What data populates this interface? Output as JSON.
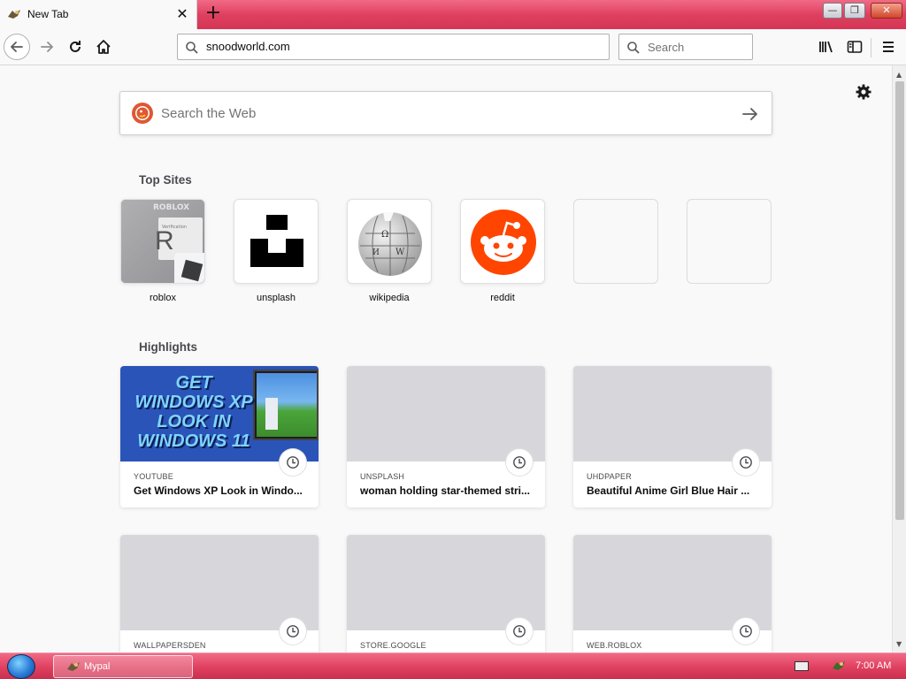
{
  "tab": {
    "title": "New Tab",
    "close_glyph": "✕",
    "new_glyph": "+"
  },
  "window_buttons": {
    "minimize": "—",
    "maximize": "❐",
    "close": "✕"
  },
  "urlbar": {
    "value": "snoodworld.com"
  },
  "searchbar": {
    "placeholder": "Search"
  },
  "websearch": {
    "placeholder": "Search the Web"
  },
  "top_sites": {
    "title": "Top Sites",
    "sites": [
      {
        "label": "roblox",
        "letter": "R",
        "logo_text": "ROBLOX",
        "thumb_text": "Verification"
      },
      {
        "label": "unsplash"
      },
      {
        "label": "wikipedia"
      },
      {
        "label": "reddit"
      },
      {
        "label": ""
      },
      {
        "label": ""
      }
    ]
  },
  "highlights": {
    "title": "Highlights",
    "thumb_text_lines": [
      "GET",
      "WINDOWS XP",
      "LOOK IN",
      "WINDOWS 11"
    ],
    "cards": [
      {
        "source": "YOUTUBE",
        "title": "Get Windows XP Look in Windo..."
      },
      {
        "source": "UNSPLASH",
        "title": "woman holding star-themed stri..."
      },
      {
        "source": "UHDPAPER",
        "title": "Beautiful Anime Girl Blue Hair ..."
      },
      {
        "source": "WALLPAPERSDEN",
        "title": ""
      },
      {
        "source": "STORE.GOOGLE",
        "title": ""
      },
      {
        "source": "WEB.ROBLOX",
        "title": ""
      }
    ]
  },
  "taskbar": {
    "app_label": "Mypal",
    "time": "7:00 AM"
  },
  "icons": [
    "back-icon",
    "forward-icon",
    "reload-icon",
    "home-icon",
    "search-icon",
    "library-icon",
    "sidebar-icon",
    "menu-icon",
    "gear-icon",
    "arrow-right-icon",
    "clock-icon"
  ],
  "colors": {
    "accent": "#e0405f",
    "reddit": "#ff4500",
    "ddg": "#de5833",
    "youtube_thumb_bg": "#2a54b8"
  }
}
